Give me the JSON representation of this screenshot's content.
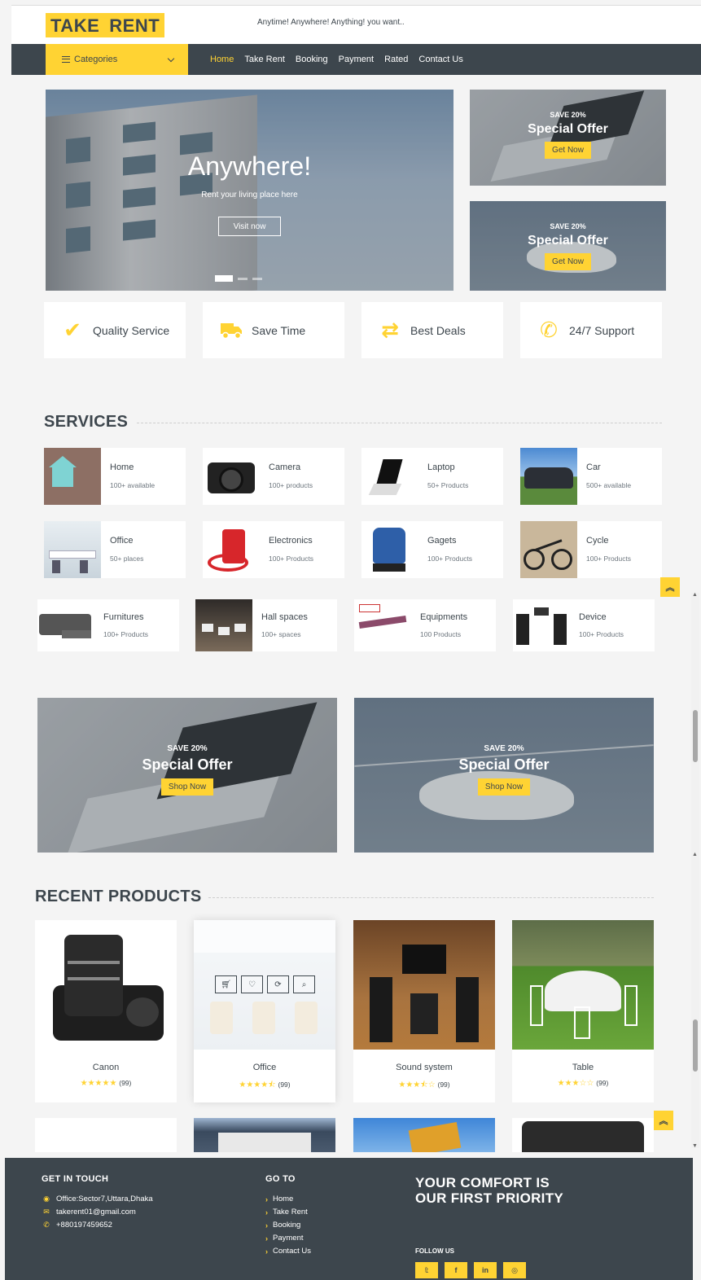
{
  "header": {
    "logo": {
      "part1": "TAKE",
      "part2": "RENT"
    },
    "tagline": "Anytime! Anywhere! Anything! you want.."
  },
  "nav": {
    "categories_label": "Categories",
    "links": [
      "Home",
      "Take Rent",
      "Booking",
      "Payment",
      "Rated",
      "Contact Us"
    ],
    "active": "Home"
  },
  "hero": {
    "title": "Anywhere!",
    "subtitle": "Rent your living place here",
    "button": "Visit now"
  },
  "side_offers": [
    {
      "save": "SAVE 20%",
      "title": "Special Offer",
      "button": "Get Now"
    },
    {
      "save": "SAVE 20%",
      "title": "Special Offer",
      "button": "Get Now"
    }
  ],
  "features": [
    {
      "label": "Quality Service",
      "icon": "check-icon"
    },
    {
      "label": "Save Time",
      "icon": "truck-icon"
    },
    {
      "label": "Best Deals",
      "icon": "exchange-icon"
    },
    {
      "label": "24/7 Support",
      "icon": "phone-icon"
    }
  ],
  "services": {
    "title": "SERVICES",
    "items": [
      {
        "name": "Home",
        "count": "100+ available"
      },
      {
        "name": "Camera",
        "count": "100+ products"
      },
      {
        "name": "Laptop",
        "count": "50+ Products"
      },
      {
        "name": "Car",
        "count": "500+ available"
      },
      {
        "name": "Office",
        "count": "50+ places"
      },
      {
        "name": "Electronics",
        "count": "100+ Products"
      },
      {
        "name": "Gagets",
        "count": "100+ Products"
      },
      {
        "name": "Cycle",
        "count": "100+ Products"
      },
      {
        "name": "Furnitures",
        "count": "100+ Products"
      },
      {
        "name": "Hall spaces",
        "count": "100+ spaces"
      },
      {
        "name": "Equipments",
        "count": "100 Products"
      },
      {
        "name": "Device",
        "count": "100+ Products"
      }
    ]
  },
  "big_offers": [
    {
      "save": "SAVE 20%",
      "title": "Special Offer",
      "button": "Shop Now"
    },
    {
      "save": "SAVE 20%",
      "title": "Special Offer",
      "button": "Shop Now"
    }
  ],
  "recent": {
    "title": "RECENT PRODUCTS",
    "products": [
      {
        "name": "Canon",
        "stars": "★★★★★",
        "count": "(99)"
      },
      {
        "name": "Office",
        "stars": "★★★★⯪",
        "count": "(99)"
      },
      {
        "name": "Sound system",
        "stars": "★★★⯪☆",
        "count": "(99)"
      },
      {
        "name": "Table",
        "stars": "★★★☆☆",
        "count": "(99)"
      }
    ],
    "product_actions": [
      "cart-icon",
      "heart-icon",
      "sync-icon",
      "search-icon"
    ]
  },
  "footer": {
    "contact_title": "GET IN TOUCH",
    "address": "Office:Sector7,Uttara,Dhaka",
    "email": "takerent01@gmail.com",
    "phone": "+880197459652",
    "goto_title": "GO TO",
    "goto_links": [
      "Home",
      "Take Rent",
      "Booking",
      "Payment",
      "Contact Us"
    ],
    "slogan": "YOUR COMFORT IS OUR FIRST PRIORITY",
    "follow": "FOLLOW US",
    "socials": [
      "twitter-icon",
      "facebook-icon",
      "linkedin-icon",
      "instagram-icon"
    ]
  },
  "colors": {
    "accent": "#ffd333",
    "dark": "#3d464d",
    "background": "#f4f4f4"
  }
}
